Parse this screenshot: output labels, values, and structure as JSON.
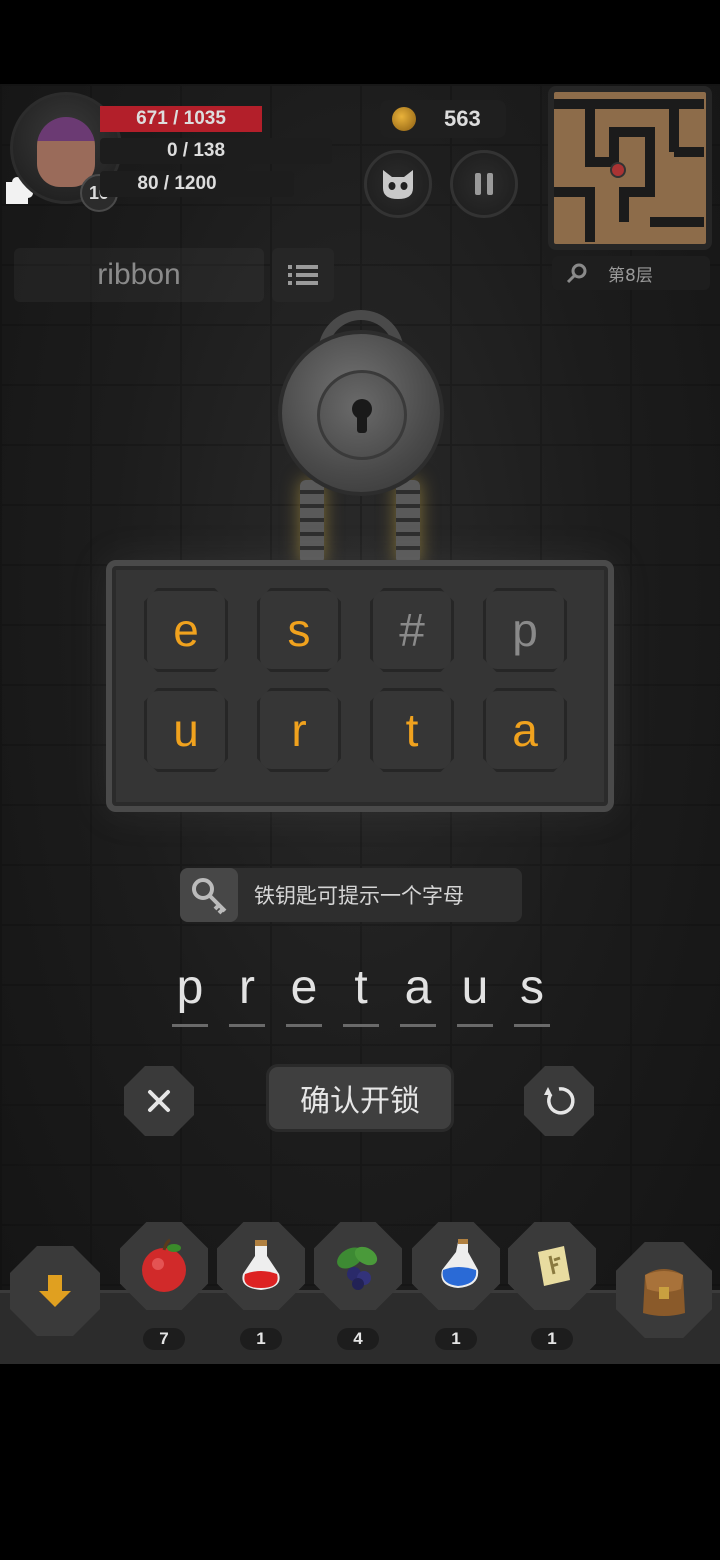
{
  "player": {
    "hp": "671 / 1035",
    "mp": "0 / 138",
    "xp": "80 / 1200",
    "level": "10"
  },
  "gold": "563",
  "floor": "第8层",
  "word_label": "ribbon",
  "puzzle": {
    "tiles": [
      "e",
      "s",
      "#",
      "p",
      "u",
      "r",
      "t",
      "a"
    ],
    "hint_text": "铁钥匙可提示一个字母",
    "answer_letters": [
      "p",
      "r",
      "e",
      "t",
      "a",
      "u",
      "s"
    ],
    "confirm_label": "确认开锁"
  },
  "inventory": [
    {
      "icon": "apple-icon",
      "count": "7"
    },
    {
      "icon": "red-potion-icon",
      "count": "1"
    },
    {
      "icon": "berries-icon",
      "count": "4"
    },
    {
      "icon": "blue-potion-icon",
      "count": "1"
    },
    {
      "icon": "rune-scroll-icon",
      "count": "1"
    }
  ],
  "colors": {
    "letter_orange": "#f0a21e",
    "hp_red": "#b31f2a",
    "background": "#1c1c1c"
  }
}
